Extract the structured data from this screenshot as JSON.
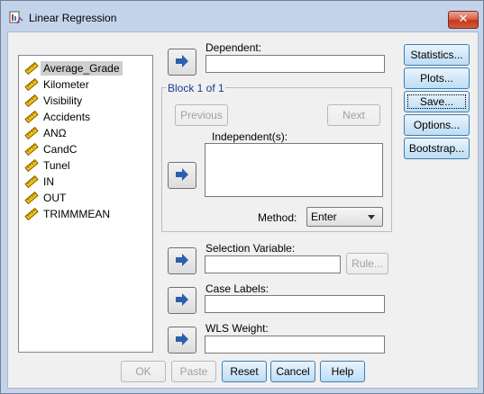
{
  "window": {
    "title": "Linear Regression"
  },
  "variables": [
    {
      "label": "Average_Grade",
      "selected": true
    },
    {
      "label": "Kilometer",
      "selected": false
    },
    {
      "label": "Visibility",
      "selected": false
    },
    {
      "label": "Accidents",
      "selected": false
    },
    {
      "label": "ANΩ",
      "selected": false
    },
    {
      "label": "CandC",
      "selected": false
    },
    {
      "label": "Tunel",
      "selected": false
    },
    {
      "label": "IN",
      "selected": false
    },
    {
      "label": "OUT",
      "selected": false
    },
    {
      "label": "TRIMMMEAN",
      "selected": false
    }
  ],
  "dependent": {
    "label": "Dependent:",
    "value": ""
  },
  "block": {
    "label": "Block 1 of 1",
    "previous_label": "Previous",
    "next_label": "Next",
    "independent_label": "Independent(s):",
    "method_label": "Method:",
    "method_value": "Enter"
  },
  "selection_variable": {
    "label": "Selection Variable:",
    "value": "",
    "rule_label": "Rule..."
  },
  "case_labels": {
    "label": "Case Labels:",
    "value": ""
  },
  "wls_weight": {
    "label": "WLS Weight:",
    "value": ""
  },
  "side_buttons": {
    "statistics": "Statistics...",
    "plots": "Plots...",
    "save": "Save...",
    "options": "Options...",
    "bootstrap": "Bootstrap..."
  },
  "bottom_buttons": {
    "ok": "OK",
    "paste": "Paste",
    "reset": "Reset",
    "cancel": "Cancel",
    "help": "Help"
  },
  "colors": {
    "accent_arrow": "#2b5fae",
    "frame": "#c3d4ea",
    "close": "#c1381d"
  }
}
